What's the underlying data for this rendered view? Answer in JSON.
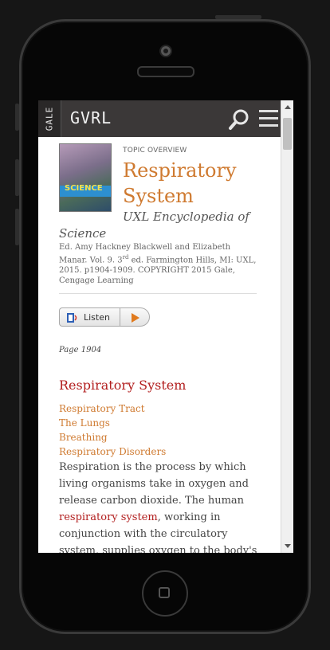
{
  "header": {
    "gale_tab": "GALE",
    "brand": "GVRL"
  },
  "article": {
    "topic_label": "TOPIC OVERVIEW",
    "title": "Respiratory System",
    "publication": "UXL Encyclopedia of Science",
    "citation": "Ed. Amy Hackney Blackwell and Elizabeth Manar. Vol. 9. 3rd ed. Farmington Hills, MI: UXL, 2015. p1904-1909. COPYRIGHT 2015 Gale, Cengage Learning",
    "cover_text": "SCIENCE",
    "listen_label": "Listen",
    "page_number": "Page 1904",
    "section_title": "Respiratory System",
    "toc": [
      "Respiratory Tract",
      "The Lungs",
      "Breathing",
      "Respiratory Disorders"
    ],
    "body_before": "Respiration is the process by which living organisms take in oxygen and release carbon dioxide. The human ",
    "body_link": "respiratory system",
    "body_after": ", working in conjunction with the circulatory system, supplies oxygen to the body's cells, removing carbon dioxide in"
  },
  "colors": {
    "accent_orange": "#cf7a30",
    "link_red": "#b21e1e",
    "topbar": "#3b3838"
  }
}
